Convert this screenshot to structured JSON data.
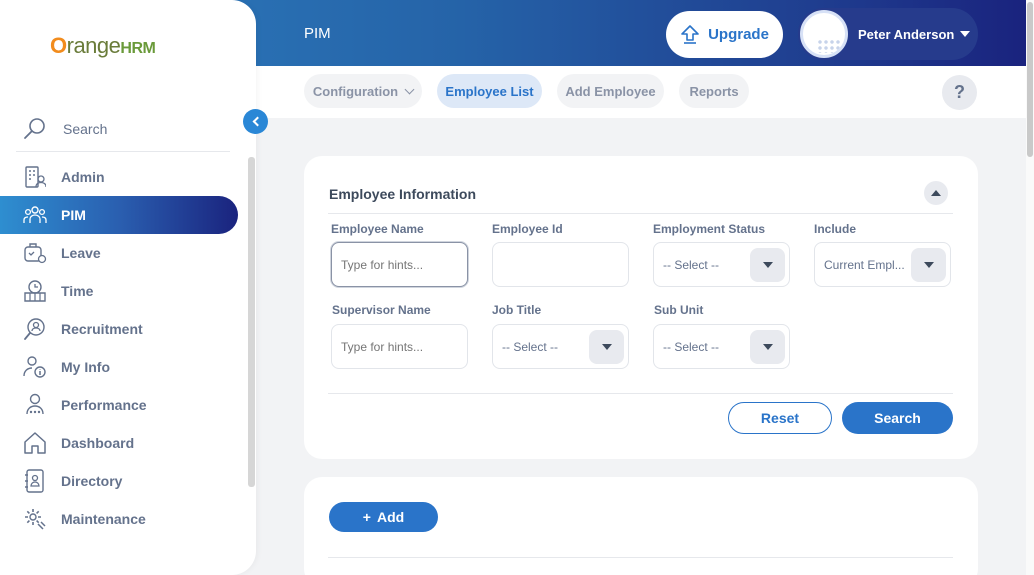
{
  "app": {
    "logo_main": "Orange",
    "logo_suffix": "HRM",
    "module_title": "PIM",
    "upgrade_label": "Upgrade",
    "user_name": "Peter Anderson",
    "help_label": "?"
  },
  "colors": {
    "accent": "#2a74c9",
    "brand_orange": "#f28c1d",
    "header_gradient_start": "#2e7ebf",
    "header_gradient_end": "#1a237e"
  },
  "tabs": [
    {
      "label": "Configuration",
      "icon": "chevron-down-icon",
      "active": false
    },
    {
      "label": "Employee List",
      "active": true
    },
    {
      "label": "Add Employee",
      "active": false
    },
    {
      "label": "Reports",
      "active": false
    }
  ],
  "sidebar": {
    "search_label": "Search",
    "items": [
      {
        "label": "Admin",
        "icon": "admin-icon"
      },
      {
        "label": "PIM",
        "icon": "pim-icon",
        "active": true
      },
      {
        "label": "Leave",
        "icon": "leave-icon"
      },
      {
        "label": "Time",
        "icon": "time-icon"
      },
      {
        "label": "Recruitment",
        "icon": "recruitment-icon"
      },
      {
        "label": "My Info",
        "icon": "my-info-icon"
      },
      {
        "label": "Performance",
        "icon": "performance-icon"
      },
      {
        "label": "Dashboard",
        "icon": "dashboard-icon"
      },
      {
        "label": "Directory",
        "icon": "directory-icon"
      },
      {
        "label": "Maintenance",
        "icon": "maintenance-icon"
      }
    ]
  },
  "filter": {
    "title": "Employee Information",
    "employee_name": {
      "label": "Employee Name",
      "placeholder": "Type for hints..."
    },
    "employee_id": {
      "label": "Employee Id",
      "value": ""
    },
    "employment_status": {
      "label": "Employment Status",
      "value": "-- Select --"
    },
    "include": {
      "label": "Include",
      "value": "Current Empl..."
    },
    "supervisor_name": {
      "label": "Supervisor Name",
      "placeholder": "Type for hints..."
    },
    "job_title": {
      "label": "Job Title",
      "value": "-- Select --"
    },
    "sub_unit": {
      "label": "Sub Unit",
      "value": "-- Select --"
    },
    "reset_label": "Reset",
    "search_label": "Search"
  },
  "list": {
    "add_label": "Add",
    "add_prefix": "+"
  }
}
